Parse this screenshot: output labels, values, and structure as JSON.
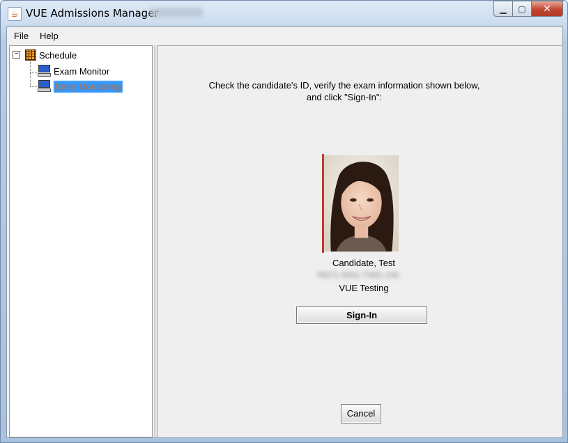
{
  "window": {
    "title": "VUE Admissions Manager",
    "title_suffix_blurred": "Site 53936",
    "app_icon": "java-cup-icon",
    "controls": {
      "minimize": "▁",
      "maximize": "▢",
      "close": "✕"
    }
  },
  "menubar": {
    "items": [
      "File",
      "Help"
    ]
  },
  "tree": {
    "root": {
      "label": "Schedule",
      "icon": "calendar-grid-icon",
      "expander": "−"
    },
    "children": [
      {
        "label": "Exam Monitor",
        "icon": "monitor-icon",
        "selected": false
      },
      {
        "label": "Entry Monitoring",
        "icon": "monitor-icon",
        "selected": true
      }
    ]
  },
  "main": {
    "instruction_line1": "Check the candidate's ID, verify the exam information shown below,",
    "instruction_line2": "and click \"Sign-In\":",
    "candidate_name": "Candidate, Test",
    "candidate_id_blurred": "REF1-0001-TNID-100",
    "site_name": "VUE Testing",
    "signin_label": "Sign-In",
    "cancel_label": "Cancel"
  },
  "colors": {
    "selection": "#3399ff",
    "panel_bg": "#f0f0f0",
    "close_button": "#c24733"
  }
}
